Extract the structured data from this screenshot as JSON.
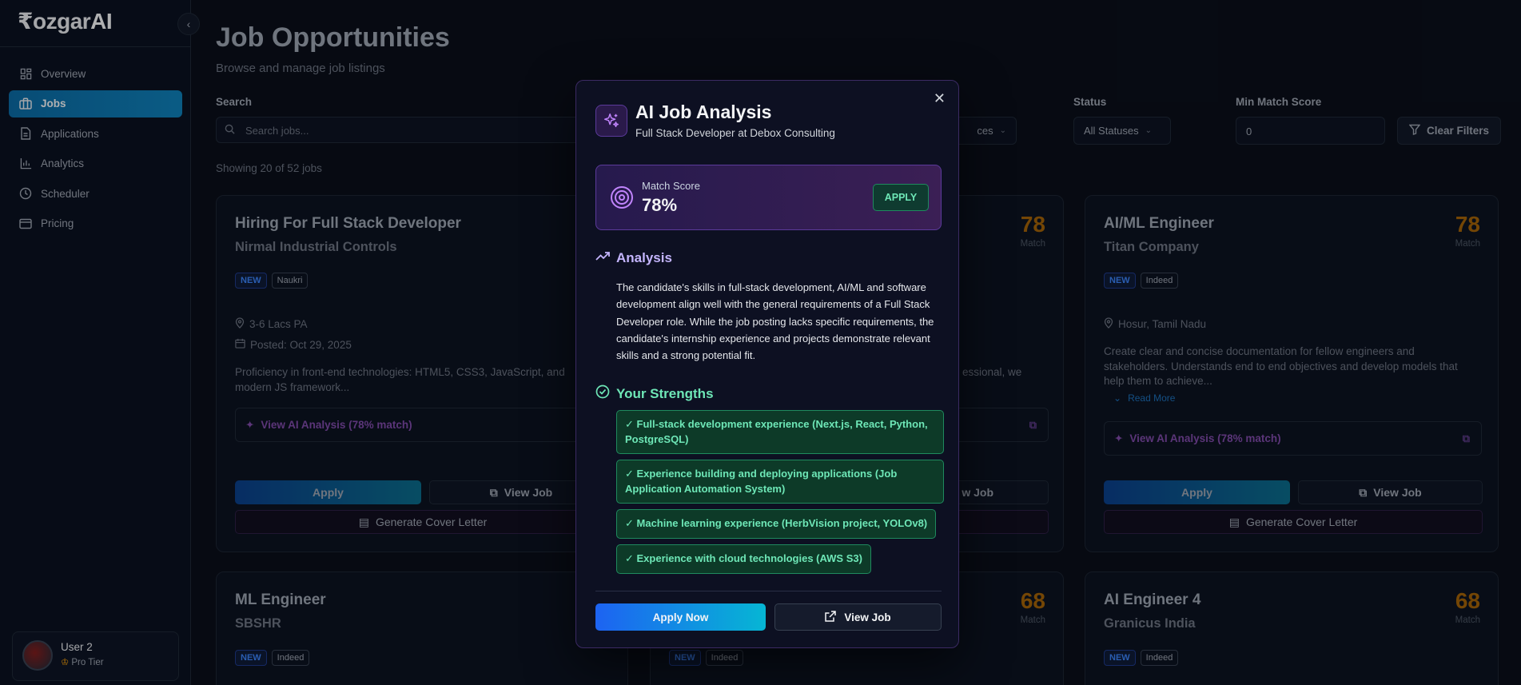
{
  "brand": {
    "logo_prefix": "₹ozgar",
    "logo_suffix": "AI"
  },
  "sidebar": {
    "items": [
      {
        "label": "Overview",
        "icon": "grid-icon"
      },
      {
        "label": "Jobs",
        "icon": "briefcase-icon",
        "active": true
      },
      {
        "label": "Applications",
        "icon": "document-icon"
      },
      {
        "label": "Analytics",
        "icon": "bar-chart-icon"
      },
      {
        "label": "Scheduler",
        "icon": "clock-icon"
      },
      {
        "label": "Pricing",
        "icon": "credit-card-icon"
      }
    ],
    "user": {
      "name": "User 2",
      "tier": "Pro Tier"
    }
  },
  "page": {
    "title": "Job Opportunities",
    "subtitle": "Browse and manage job listings"
  },
  "filters": {
    "search_label": "Search",
    "search_placeholder": "Search jobs...",
    "source_value": "ces",
    "status_label": "Status",
    "status_value": "All Statuses",
    "min_label": "Min Match Score",
    "min_value": "0",
    "clear_label": "Clear Filters"
  },
  "showing": "Showing 20 of 52 jobs",
  "cards": [
    {
      "title": "Hiring For Full Stack Developer",
      "company": "Nirmal Industrial Controls",
      "badge_new": "NEW",
      "source": "Naukri",
      "salary": "3-6 Lacs PA",
      "posted": "Posted: Oct 29, 2025",
      "desc": "Proficiency in front-end technologies: HTML5, CSS3, JavaScript, and modern JS framework...",
      "ai_link": "View AI Analysis (78% match)",
      "apply": "Apply",
      "view": "View Job",
      "cover": "Generate Cover Letter"
    },
    {
      "score": "78",
      "match": "Match",
      "desc_tail": "essional, we",
      "view": "w Job"
    },
    {
      "title": "AI/ML Engineer",
      "company": "Titan Company",
      "score": "78",
      "match": "Match",
      "badge_new": "NEW",
      "source": "Indeed",
      "location": "Hosur, Tamil Nadu",
      "desc": "Create clear and concise documentation for fellow engineers and stakeholders. Understands end to end objectives and develop models that help them to achieve...",
      "read_more": "Read More",
      "ai_link": "View AI Analysis (78% match)",
      "apply": "Apply",
      "view": "View Job",
      "cover": "Generate Cover Letter"
    },
    {
      "title": "ML Engineer",
      "company": "SBSHR",
      "badge_new": "NEW",
      "source": "Indeed"
    },
    {
      "score": "68",
      "match": "Match",
      "badge_new": "NEW",
      "source": "Indeed"
    },
    {
      "title": "AI Engineer 4",
      "company": "Granicus India",
      "score": "68",
      "match": "Match",
      "badge_new": "NEW",
      "source": "Indeed"
    }
  ],
  "modal": {
    "title": "AI Job Analysis",
    "subtitle": "Full Stack Developer at Debox Consulting",
    "match_label": "Match Score",
    "match_value": "78%",
    "apply_tag": "APPLY",
    "analysis_heading": "Analysis",
    "analysis_text": "The candidate's skills in full-stack development, AI/ML and software development align well with the general requirements of a Full Stack Developer role. While the job posting lacks specific requirements, the candidate's internship experience and projects demonstrate relevant skills and a strong potential fit.",
    "strengths_heading": "Your Strengths",
    "strengths": [
      "✓ Full-stack development experience (Next.js, React, Python, PostgreSQL)",
      "✓ Experience building and deploying applications (Job Application Automation System)",
      "✓ Machine learning experience (HerbVision project, YOLOv8)",
      "✓ Experience with cloud technologies (AWS S3)"
    ],
    "apply_now": "Apply Now",
    "view_job": "View Job"
  }
}
